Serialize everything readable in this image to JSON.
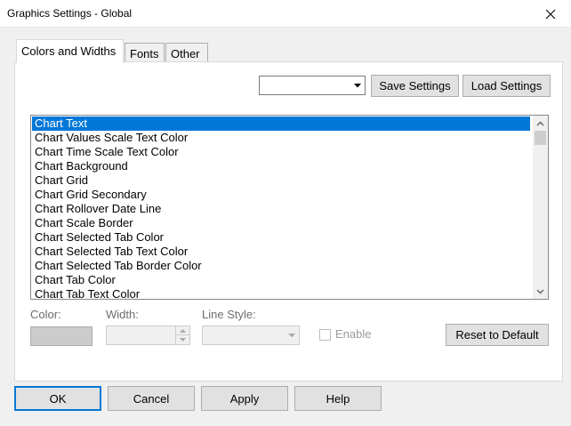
{
  "window": {
    "title": "Graphics Settings - Global",
    "close_icon": "close-icon"
  },
  "tabs": [
    {
      "label": "Colors and Widths",
      "active": true
    },
    {
      "label": "Fonts",
      "active": false
    },
    {
      "label": "Other",
      "active": false
    }
  ],
  "toolbar": {
    "settings_combo_value": "",
    "save_label": "Save Settings",
    "load_label": "Load Settings"
  },
  "list": {
    "items": [
      "Chart Text",
      "Chart Values Scale Text Color",
      "Chart Time Scale Text Color",
      "Chart Background",
      "Chart Grid",
      "Chart Grid Secondary",
      "Chart Rollover Date Line",
      "Chart Scale Border",
      "Chart Selected Tab Color",
      "Chart Selected Tab Text Color",
      "Chart Selected Tab Border Color",
      "Chart Tab Color",
      "Chart Tab Text Color"
    ],
    "selected_index": 0
  },
  "properties": {
    "color_label": "Color:",
    "width_label": "Width:",
    "line_style_label": "Line Style:",
    "width_value": "",
    "line_style_value": "",
    "enable_label": "Enable",
    "enable_checked": false,
    "color_swatch": "#cccccc",
    "reset_label": "Reset to Default"
  },
  "footer": {
    "ok_label": "OK",
    "cancel_label": "Cancel",
    "apply_label": "Apply",
    "help_label": "Help"
  },
  "colors": {
    "selection": "#0078d7",
    "focus_border": "#0078d7"
  }
}
